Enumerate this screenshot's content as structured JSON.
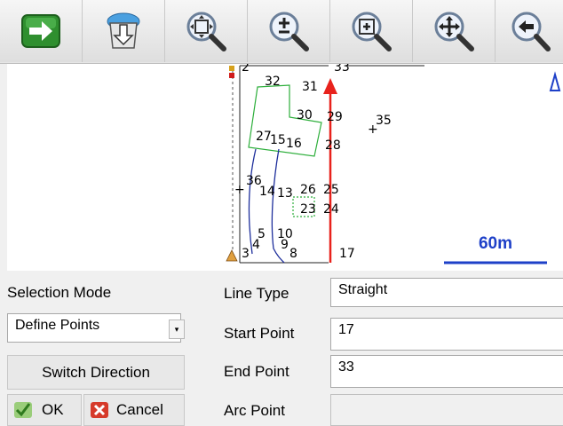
{
  "toolbar": {
    "buttons": [
      {
        "name": "go-arrow-icon"
      },
      {
        "name": "save-download-icon"
      },
      {
        "name": "zoom-extents-icon"
      },
      {
        "name": "zoom-in-out-icon"
      },
      {
        "name": "zoom-window-icon"
      },
      {
        "name": "pan-icon"
      },
      {
        "name": "back-icon"
      }
    ]
  },
  "map": {
    "point_labels": [
      "2",
      "33",
      "32",
      "31",
      "30",
      "29",
      "35",
      "27",
      "15",
      "16",
      "28",
      "36",
      "14",
      "13",
      "26",
      "25",
      "23",
      "24",
      "5",
      "10",
      "3",
      "4",
      "9",
      "8",
      "17"
    ],
    "scale_label": "60m",
    "colors": {
      "line": "#e8221c",
      "polygon": "#2cae3a",
      "path": "#1e2f9c",
      "scale": "#1e40c8"
    }
  },
  "panel": {
    "selection_mode_label": "Selection Mode",
    "selection_mode_value": "Define Points",
    "switch_direction_label": "Switch Direction",
    "ok_label": "OK",
    "cancel_label": "Cancel",
    "line_type_label": "Line Type",
    "line_type_value": "Straight",
    "start_point_label": "Start Point",
    "start_point_value": "17",
    "end_point_label": "End Point",
    "end_point_value": "33",
    "arc_point_label": "Arc Point",
    "arc_point_value": ""
  }
}
